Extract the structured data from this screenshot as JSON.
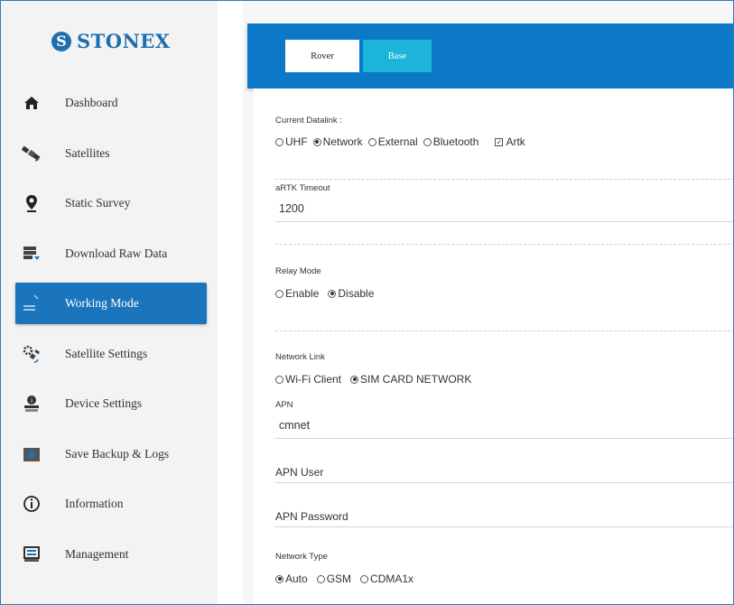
{
  "brand": {
    "mark": "S",
    "name": "STONEX"
  },
  "sidebar": {
    "items": [
      {
        "label": "Dashboard",
        "icon": "home-icon"
      },
      {
        "label": "Satellites",
        "icon": "satellite-icon"
      },
      {
        "label": "Static Survey",
        "icon": "location-pin-icon"
      },
      {
        "label": "Download Raw Data",
        "icon": "download-data-icon"
      },
      {
        "label": "Working Mode",
        "icon": "working-mode-icon",
        "active": true
      },
      {
        "label": "Satellite Settings",
        "icon": "satellite-settings-icon"
      },
      {
        "label": "Device Settings",
        "icon": "device-settings-icon"
      },
      {
        "label": "Save Backup & Logs",
        "icon": "save-backup-icon"
      },
      {
        "label": "Information",
        "icon": "info-icon"
      },
      {
        "label": "Management",
        "icon": "management-icon"
      }
    ]
  },
  "header": {
    "tabs": [
      {
        "label": "Rover",
        "selected": true
      },
      {
        "label": "Base",
        "selected": false
      }
    ]
  },
  "datalink": {
    "label": "Current Datalink :",
    "options": [
      "UHF",
      "Network",
      "External",
      "Bluetooth"
    ],
    "selected": "Network",
    "artk_label": "Artk",
    "artk_checked": true
  },
  "artk_timeout": {
    "label": "aRTK Timeout",
    "value": "1200"
  },
  "relay_mode": {
    "label": "Relay Mode",
    "options": [
      "Enable",
      "Disable"
    ],
    "selected": "Disable"
  },
  "network_link": {
    "label": "Network Link",
    "options": [
      "Wi-Fi Client",
      "SIM CARD NETWORK"
    ],
    "selected": "SIM CARD NETWORK"
  },
  "apn": {
    "label": "APN",
    "value": "cmnet"
  },
  "apn_user": {
    "label": "APN User",
    "value": ""
  },
  "apn_password": {
    "label": "APN Password",
    "value": ""
  },
  "network_type": {
    "label": "Network Type",
    "options": [
      "Auto",
      "GSM",
      "CDMA1x"
    ],
    "selected": "Auto"
  },
  "colors": {
    "accent": "#1a75bd",
    "header": "#0b79c7",
    "base_tab": "#1cb4d8",
    "brand": "#1f6fae"
  }
}
